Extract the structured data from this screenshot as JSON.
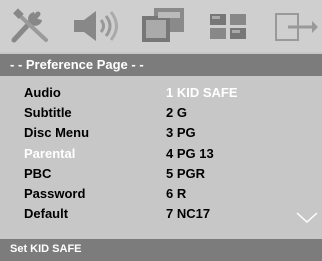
{
  "header": {
    "title": "- -  Preference Page  - -"
  },
  "icons": [
    "general-setup-icon",
    "audio-setup-icon",
    "video-setup-icon",
    "preference-icon",
    "exit-icon"
  ],
  "menu": {
    "labels": [
      "Audio",
      "Subtitle",
      "Disc Menu",
      "Parental",
      "PBC",
      "Password",
      "Default"
    ],
    "values": [
      "1 KID SAFE",
      "2 G",
      "3 PG",
      "4 PG 13",
      "5 PGR",
      "6 R",
      "7 NC17"
    ],
    "active_label": "Parental",
    "selected_value": "1 KID SAFE"
  },
  "status": {
    "text": "Set KID SAFE"
  },
  "colors": {
    "panel": "#c7c7c7",
    "bar": "#7c7c7c",
    "highlight": "#ffffff",
    "text": "#000000"
  }
}
